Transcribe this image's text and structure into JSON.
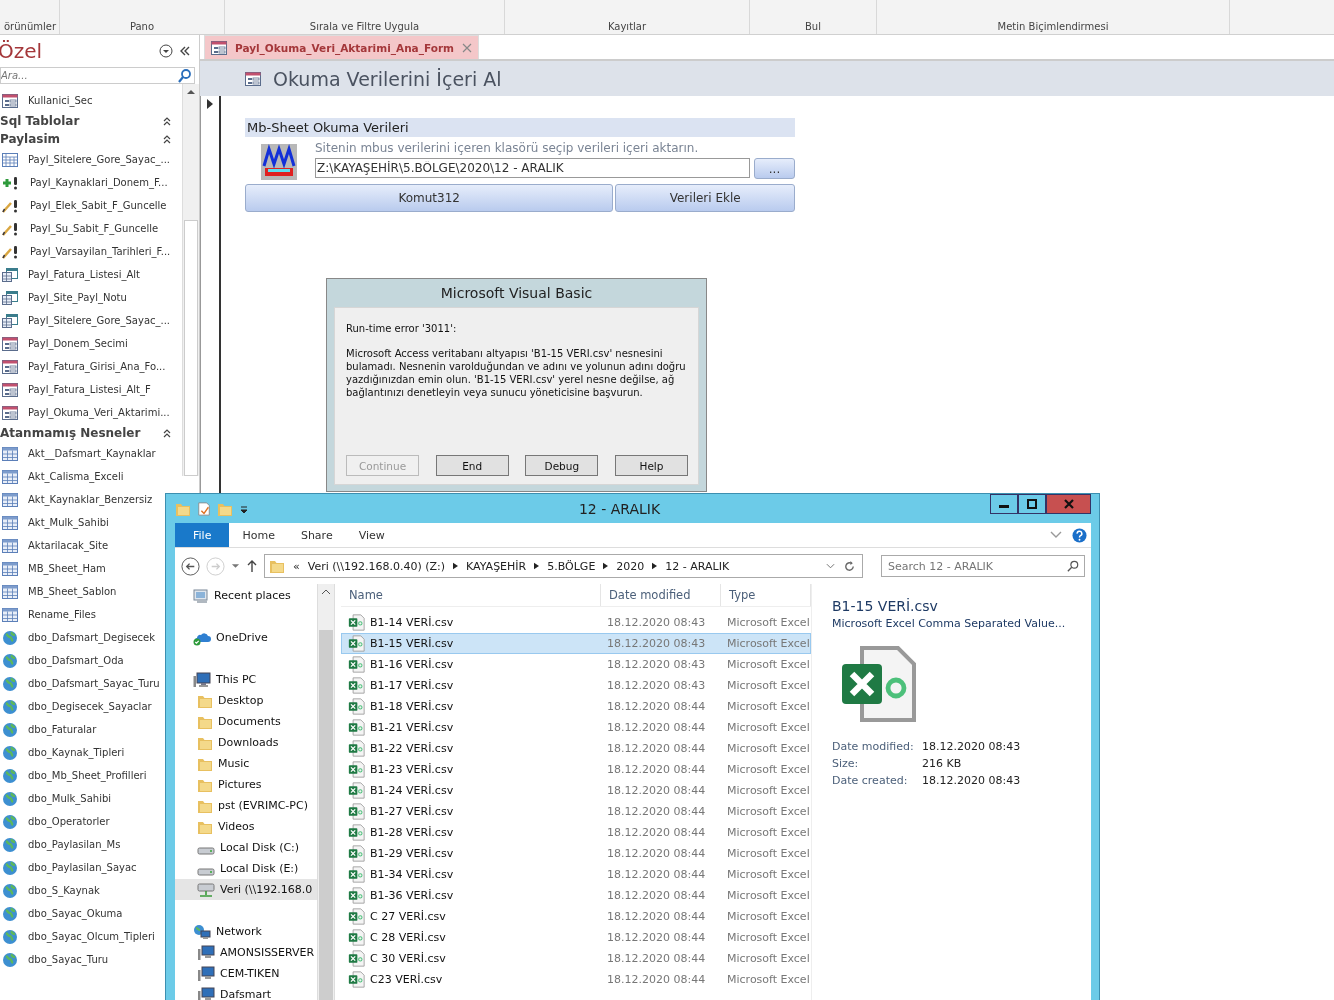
{
  "ribbon": {
    "groups": [
      {
        "label": "örünümler"
      },
      {
        "label": "Pano"
      },
      {
        "label": "Sırala ve Filtre Uygula"
      },
      {
        "label": "Kayıtlar"
      },
      {
        "label": "Bul"
      },
      {
        "label": "Metin Biçimlendirmesi"
      }
    ]
  },
  "nav_pane": {
    "title": "Özel",
    "search": {
      "placeholder": "Ara..."
    },
    "items": [
      {
        "kind": "form",
        "label": "Kullanici_Sec"
      },
      {
        "kind": "group",
        "label": "Sql Tablolar",
        "expanded": true
      },
      {
        "kind": "group",
        "label": "Paylasim",
        "expanded": true
      },
      {
        "kind": "crosstab-query",
        "label": "Payl_Sitelere_Gore_Sayac_..."
      },
      {
        "kind": "append-query",
        "label": "Payl_Kaynaklari_Donem_F..."
      },
      {
        "kind": "update-query",
        "label": "Payl_Elek_Sabit_F_Guncelle"
      },
      {
        "kind": "update-query",
        "label": "Payl_Su_Sabit_F_Guncelle"
      },
      {
        "kind": "update-query",
        "label": "Payl_Varsayilan_Tarihleri_F..."
      },
      {
        "kind": "subform",
        "label": "Payl_Fatura_Listesi_Alt"
      },
      {
        "kind": "subform",
        "label": "Payl_Site_Payl_Notu"
      },
      {
        "kind": "subform",
        "label": "Payl_Sitelere_Gore_Sayac_..."
      },
      {
        "kind": "form",
        "label": "Payl_Donem_Secimi"
      },
      {
        "kind": "form",
        "label": "Payl_Fatura_Girisi_Ana_Fo..."
      },
      {
        "kind": "form",
        "label": "Payl_Fatura_Listesi_Alt_F"
      },
      {
        "kind": "form",
        "label": "Payl_Okuma_Veri_Aktarimi..."
      },
      {
        "kind": "group",
        "label": "Atanmamış Nesneler",
        "expanded": true
      },
      {
        "kind": "table",
        "label": "Akt__Dafsmart_Kaynaklar"
      },
      {
        "kind": "table",
        "label": "Akt_Calisma_Exceli"
      },
      {
        "kind": "table",
        "label": "Akt_Kaynaklar_Benzersiz"
      },
      {
        "kind": "table",
        "label": "Akt_Mulk_Sahibi"
      },
      {
        "kind": "table",
        "label": "Aktarilacak_Site"
      },
      {
        "kind": "table",
        "label": "MB_Sheet_Ham"
      },
      {
        "kind": "table",
        "label": "MB_Sheet_Sablon"
      },
      {
        "kind": "table",
        "label": "Rename_Files"
      },
      {
        "kind": "linked-table",
        "label": "dbo_Dafsmart_Degisecek"
      },
      {
        "kind": "linked-table",
        "label": "dbo_Dafsmart_Oda"
      },
      {
        "kind": "linked-table",
        "label": "dbo_Dafsmart_Sayac_Turu"
      },
      {
        "kind": "linked-table",
        "label": "dbo_Degisecek_Sayaclar"
      },
      {
        "kind": "linked-table",
        "label": "dbo_Faturalar"
      },
      {
        "kind": "linked-table",
        "label": "dbo_Kaynak_Tipleri"
      },
      {
        "kind": "linked-table",
        "label": "dbo_Mb_Sheet_Profilleri"
      },
      {
        "kind": "linked-table",
        "label": "dbo_Mulk_Sahibi"
      },
      {
        "kind": "linked-table",
        "label": "dbo_Operatorler"
      },
      {
        "kind": "linked-table",
        "label": "dbo_Paylasilan_Ms"
      },
      {
        "kind": "linked-table",
        "label": "dbo_Paylasilan_Sayac"
      },
      {
        "kind": "linked-table",
        "label": "dbo_S_Kaynak"
      },
      {
        "kind": "linked-table",
        "label": "dbo_Sayac_Okuma"
      },
      {
        "kind": "linked-table",
        "label": "dbo_Sayac_Olcum_Tipleri"
      },
      {
        "kind": "linked-table",
        "label": "dbo_Sayac_Turu"
      }
    ]
  },
  "document_tabs": [
    {
      "label": "Payl_Okuma_Veri_Aktarimi_Ana_Form",
      "selected": true
    }
  ],
  "form": {
    "title": "Okuma Verilerini İçeri Al",
    "section_title": "Mb-Sheet Okuma Verileri",
    "hint": "Sitenin mbus verilerini içeren klasörü seçip verileri içeri aktarın.",
    "path_field": {
      "value": "Z:\\KAYAŞEHİR\\5.BÖLGE\\2020\\12 - ARALIK"
    },
    "browse_button": "...",
    "buttons": [
      "Komut312",
      "Verileri Ekle"
    ]
  },
  "dialog": {
    "title": "Microsoft Visual Basic",
    "error": "Run-time error '3011':",
    "message": "Microsoft Access veritabanı altyapısı 'B1-15  VERI.csv' nesnesini bulamadı. Nesnenin varolduğundan ve adını ve yolunun adını doğru yazdığınızdan emin olun. 'B1-15  VERI.csv' yerel nesne değilse, ağ bağlantınızı denetleyin veya sunucu yöneticisine başvurun.",
    "buttons": [
      {
        "label": "Continue",
        "disabled": true
      },
      {
        "label": "End",
        "disabled": false
      },
      {
        "label": "Debug",
        "disabled": false
      },
      {
        "label": "Help",
        "disabled": false
      }
    ]
  },
  "explorer": {
    "title": "12 - ARALIK",
    "tabs": [
      {
        "label": "File",
        "selected": true
      },
      {
        "label": "Home",
        "selected": false
      },
      {
        "label": "Share",
        "selected": false
      },
      {
        "label": "View",
        "selected": false
      }
    ],
    "address": {
      "overflow": "«",
      "parts": [
        "Veri (\\\\192.168.0.40) (Z:)",
        "KAYAŞEHİR",
        "5.BÖLGE",
        "2020",
        "12 - ARALIK"
      ]
    },
    "search": {
      "placeholder": "Search 12 - ARALIK"
    },
    "nav_tree": [
      {
        "kind": "recent",
        "label": "Recent places",
        "selected": false
      },
      {
        "kind": "cloud",
        "label": "OneDrive",
        "selected": false
      },
      {
        "kind": "pc",
        "label": "This PC",
        "selected": false,
        "children": [
          {
            "kind": "folder",
            "label": "Desktop",
            "selected": false
          },
          {
            "kind": "folder",
            "label": "Documents",
            "selected": false
          },
          {
            "kind": "folder",
            "label": "Downloads",
            "selected": false
          },
          {
            "kind": "folder",
            "label": "Music",
            "selected": false
          },
          {
            "kind": "folder",
            "label": "Pictures",
            "selected": false
          },
          {
            "kind": "folder",
            "label": "pst (EVRIMC-PC)",
            "selected": false
          },
          {
            "kind": "folder",
            "label": "Videos",
            "selected": false
          },
          {
            "kind": "disk",
            "label": "Local Disk (C:)",
            "selected": false
          },
          {
            "kind": "disk",
            "label": "Local Disk (E:)",
            "selected": false
          },
          {
            "kind": "network-drive",
            "label": "Veri (\\\\192.168.0",
            "selected": true
          }
        ]
      },
      {
        "kind": "network",
        "label": "Network",
        "selected": false,
        "children": [
          {
            "kind": "computer",
            "label": "AMONSISSERVER",
            "selected": false
          },
          {
            "kind": "computer",
            "label": "CEM-TIKEN",
            "selected": false
          },
          {
            "kind": "computer",
            "label": "Dafsmart",
            "selected": false
          }
        ]
      }
    ],
    "columns": [
      "Name",
      "Date modified",
      "Type"
    ],
    "files": [
      {
        "name": "B1-14  VERİ.csv",
        "date": "18.12.2020 08:43",
        "type": "Microsoft Excel",
        "selected": false
      },
      {
        "name": "B1-15  VERİ.csv",
        "date": "18.12.2020 08:43",
        "type": "Microsoft Excel",
        "selected": true
      },
      {
        "name": "B1-16  VERİ.csv",
        "date": "18.12.2020 08:43",
        "type": "Microsoft Excel",
        "selected": false
      },
      {
        "name": "B1-17  VERİ.csv",
        "date": "18.12.2020 08:43",
        "type": "Microsoft Excel",
        "selected": false
      },
      {
        "name": "B1-18  VERİ.csv",
        "date": "18.12.2020 08:44",
        "type": "Microsoft Excel",
        "selected": false
      },
      {
        "name": "B1-21  VERİ.csv",
        "date": "18.12.2020 08:44",
        "type": "Microsoft Excel",
        "selected": false
      },
      {
        "name": "B1-22  VERİ.csv",
        "date": "18.12.2020 08:44",
        "type": "Microsoft Excel",
        "selected": false
      },
      {
        "name": "B1-23  VERİ.csv",
        "date": "18.12.2020 08:44",
        "type": "Microsoft Excel",
        "selected": false
      },
      {
        "name": "B1-24  VERİ.csv",
        "date": "18.12.2020 08:44",
        "type": "Microsoft Excel",
        "selected": false
      },
      {
        "name": "B1-27 VERİ.csv",
        "date": "18.12.2020 08:44",
        "type": "Microsoft Excel",
        "selected": false
      },
      {
        "name": "B1-28  VERİ.csv",
        "date": "18.12.2020 08:44",
        "type": "Microsoft Excel",
        "selected": false
      },
      {
        "name": "B1-29  VERİ.csv",
        "date": "18.12.2020 08:44",
        "type": "Microsoft Excel",
        "selected": false
      },
      {
        "name": "B1-34  VERİ.csv",
        "date": "18.12.2020 08:44",
        "type": "Microsoft Excel",
        "selected": false
      },
      {
        "name": "B1-36 VERİ.csv",
        "date": "18.12.2020 08:44",
        "type": "Microsoft Excel",
        "selected": false
      },
      {
        "name": "C 27 VERİ.csv",
        "date": "18.12.2020 08:44",
        "type": "Microsoft Excel",
        "selected": false
      },
      {
        "name": "C 28 VERİ.csv",
        "date": "18.12.2020 08:44",
        "type": "Microsoft Excel",
        "selected": false
      },
      {
        "name": "C 30 VERİ.csv",
        "date": "18.12.2020 08:44",
        "type": "Microsoft Excel",
        "selected": false
      },
      {
        "name": "C23  VERİ.csv",
        "date": "18.12.2020 08:44",
        "type": "Microsoft Excel",
        "selected": false
      }
    ],
    "details": {
      "name": "B1-15  VERİ.csv",
      "type": "Microsoft Excel Comma Separated Value...",
      "properties": [
        {
          "label": "Date modified:",
          "value": "18.12.2020 08:43"
        },
        {
          "label": "Size:",
          "value": "216 KB"
        },
        {
          "label": "Date created:",
          "value": "18.12.2020 08:43"
        }
      ]
    }
  }
}
